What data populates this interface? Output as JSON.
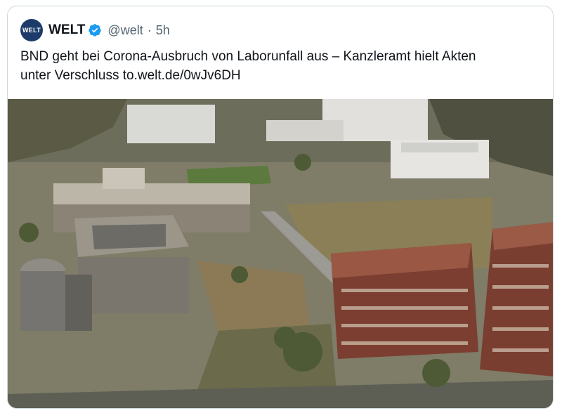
{
  "tweet": {
    "avatar_text": "WELT",
    "display_name": "WELT",
    "handle": "@welt",
    "separator": "·",
    "time": "5h",
    "text_line1": "BND geht bei Corona-Ausbruch von Laborunfall aus – Kanzleramt hielt Akten",
    "text_line2": "unter Verschluss to.welt.de/0wJv6DH",
    "verified_icon": "verified-badge-icon"
  },
  "colors": {
    "verified": "#1d9bf0",
    "avatar_bg": "#1d3b6a",
    "text": "#0f1419",
    "muted": "#536471"
  },
  "media": {
    "description_icon": "aerial-photo"
  }
}
